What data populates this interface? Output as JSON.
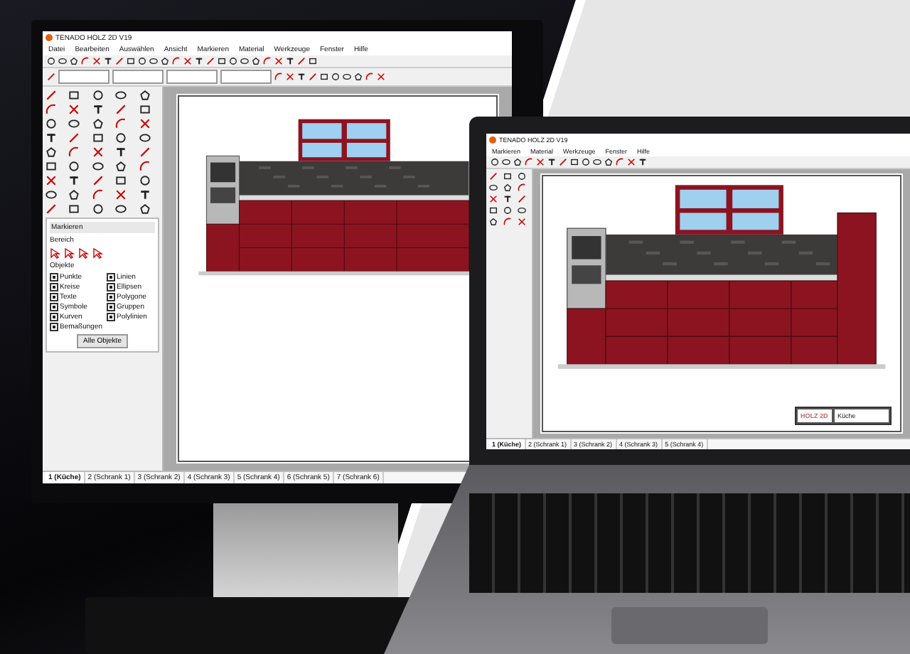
{
  "desktop": {
    "app": {
      "title": "TENADO HOLZ 2D V19",
      "menu": [
        "Datei",
        "Bearbeiten",
        "Auswählen",
        "Ansicht",
        "Markieren",
        "Material",
        "Werkzeuge",
        "Fenster",
        "Hilfe"
      ],
      "panel": {
        "title": "Markieren",
        "area_label": "Bereich",
        "objects_label": "Objekte",
        "filters": [
          {
            "label": "Punkte",
            "checked": true
          },
          {
            "label": "Linien",
            "checked": true
          },
          {
            "label": "Kreise",
            "checked": true
          },
          {
            "label": "Ellipsen",
            "checked": true
          },
          {
            "label": "Texte",
            "checked": true
          },
          {
            "label": "Polygone",
            "checked": true
          },
          {
            "label": "Symbole",
            "checked": true
          },
          {
            "label": "Gruppen",
            "checked": true
          },
          {
            "label": "Kurven",
            "checked": true
          },
          {
            "label": "Polylinien",
            "checked": true
          },
          {
            "label": "Bemaßungen",
            "checked": true
          }
        ],
        "button": "Alle Objekte"
      },
      "sheet_tabs": [
        {
          "label": "1 (Küche)",
          "selected": true
        },
        {
          "label": "2 (Schrank 1)",
          "selected": false
        },
        {
          "label": "3 (Schrank 2)",
          "selected": false
        },
        {
          "label": "4 (Schrank 3)",
          "selected": false
        },
        {
          "label": "5 (Schrank 4)",
          "selected": false
        },
        {
          "label": "6 (Schrank 5)",
          "selected": false
        },
        {
          "label": "7 (Schrank 6)",
          "selected": false
        }
      ]
    }
  },
  "laptop": {
    "app": {
      "title": "TENADO HOLZ 2D V19",
      "menu": [
        "Markieren",
        "Material",
        "Werkzeuge",
        "Fenster",
        "Hilfe"
      ],
      "title_block": {
        "room": "Küche",
        "logo": "HOLZ 2D"
      },
      "sheet_tabs": [
        {
          "label": "1 (Küche)",
          "selected": true
        },
        {
          "label": "2 (Schrank 1)",
          "selected": false
        },
        {
          "label": "3 (Schrank 2)",
          "selected": false
        },
        {
          "label": "4 (Schrank 3)",
          "selected": false
        },
        {
          "label": "5 (Schrank 4)",
          "selected": false
        }
      ]
    }
  }
}
